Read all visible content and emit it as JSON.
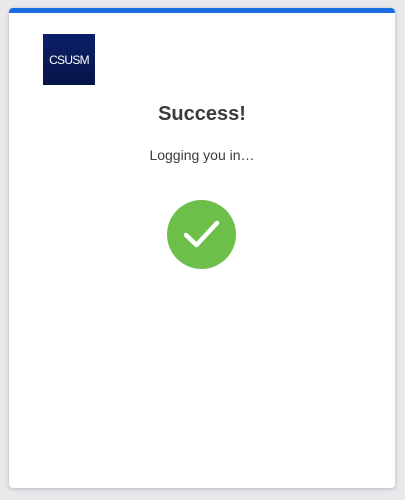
{
  "brand": {
    "logo_text": "CSUSM",
    "accent_color": "#1a6ee1",
    "success_color": "#6cc04a"
  },
  "status": {
    "title": "Success!",
    "message": "Logging you in…",
    "icon": "check-circle-icon"
  }
}
